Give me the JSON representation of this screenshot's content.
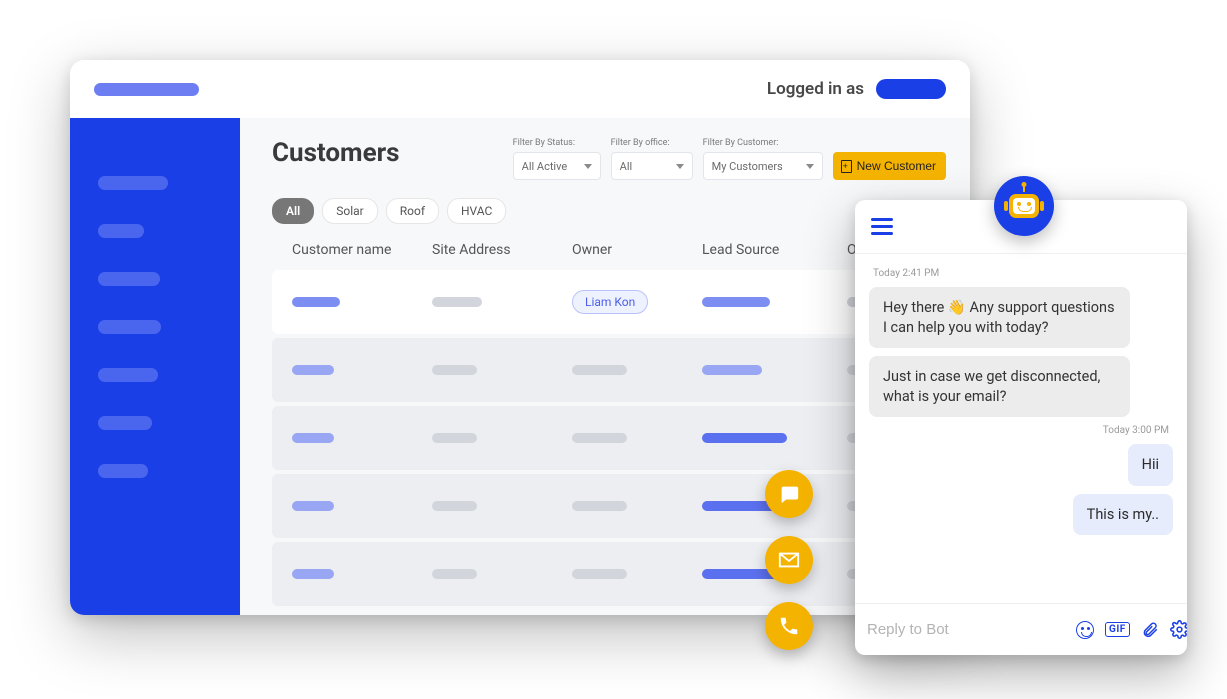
{
  "header": {
    "logged_in_label": "Logged in as"
  },
  "page": {
    "title": "Customers"
  },
  "filters": {
    "status": {
      "label": "Filter By Status:",
      "value": "All Active"
    },
    "office": {
      "label": "Filter By office:",
      "value": "All"
    },
    "customer": {
      "label": "Filter By Customer:",
      "value": "My Customers"
    }
  },
  "actions": {
    "new_customer": "New Customer"
  },
  "tabs": {
    "all": "All",
    "solar": "Solar",
    "roof": "Roof",
    "hvac": "HVAC"
  },
  "columns": {
    "customer_name": "Customer name",
    "site_address": "Site Address",
    "owner": "Owner",
    "lead_source": "Lead Source",
    "office": "Office"
  },
  "rows": {
    "first_owner": "Liam Kon"
  },
  "chat": {
    "ts_bot": "Today 2:41 PM",
    "bot_msg_1_pre": "Hey there ",
    "bot_msg_1_post": " Any support questions I can help you with today?",
    "bot_msg_2": "Just in case we get disconnected, what is your email?",
    "ts_user": "Today 3:00 PM",
    "user_msg_1": "Hii",
    "user_msg_2": "This is my..",
    "input_placeholder": "Reply to Bot",
    "gif_label": "GIF"
  }
}
